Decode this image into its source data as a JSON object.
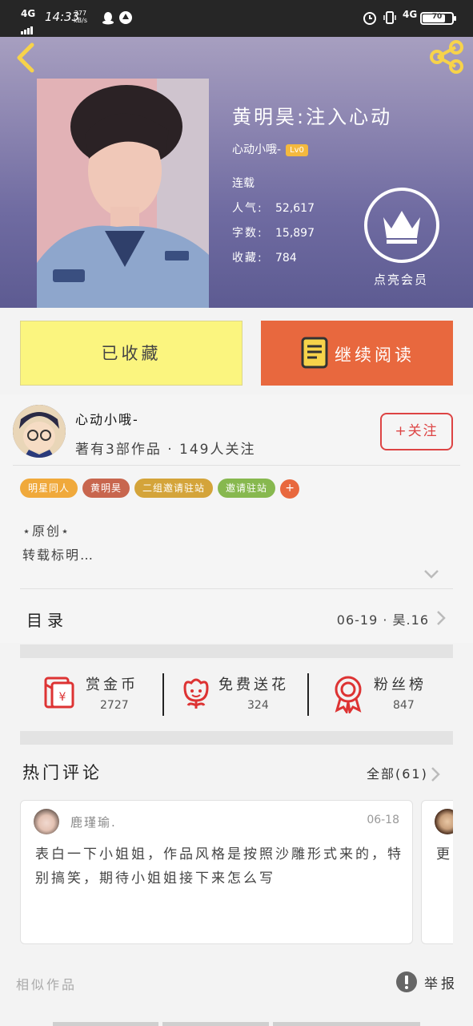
{
  "status_bar": {
    "network": "4G",
    "time": "14:33",
    "speed_top": "277",
    "speed_unit": "kB/s",
    "right_network": "4G",
    "battery": "70"
  },
  "book": {
    "title": "黄明昊:注入心动",
    "author": "心动小哦-",
    "level": "Lv0",
    "status": "连载",
    "stats": [
      {
        "label": "人气:",
        "value": "52,617"
      },
      {
        "label": "字数:",
        "value": "15,897"
      },
      {
        "label": "收藏:",
        "value": "784"
      }
    ],
    "vip_label": "点亮会员"
  },
  "buttons": {
    "collected": "已收藏",
    "continue": "继续阅读"
  },
  "author": {
    "name": "心动小哦-",
    "meta": "著有3部作品 · 149人关注",
    "follow": "+关注"
  },
  "tags": [
    {
      "label": "明星同人",
      "color": "#f0a93b"
    },
    {
      "label": "黄明昊",
      "color": "#c8664e"
    },
    {
      "label": "二组邀请驻站",
      "color": "#d4a43a"
    },
    {
      "label": "邀请驻站",
      "color": "#87b84f"
    }
  ],
  "tag_add": "+",
  "description": {
    "line1": "⋆原创⋆",
    "line2": "转载标明…"
  },
  "toc": {
    "label": "目录",
    "latest": "06-19 · 昊.16"
  },
  "actions": [
    {
      "label": "赏金币",
      "value": "2727",
      "icon": "red-envelope-icon"
    },
    {
      "label": "免费送花",
      "value": "324",
      "icon": "flower-icon"
    },
    {
      "label": "粉丝榜",
      "value": "847",
      "icon": "medal-icon"
    }
  ],
  "comments": {
    "title": "热门评论",
    "all": "全部(61)",
    "items": [
      {
        "user": "鹿瑾瑜.",
        "date": "06-18",
        "text": "表白一下小姐姐，作品风格是按照沙雕形式来的，特别搞笑，期待小姐姐接下来怎么写"
      },
      {
        "text": "更"
      }
    ]
  },
  "footer": {
    "similar": "相似作品",
    "report": "举报"
  },
  "colors": {
    "accent_orange": "#e8683e",
    "collected_yellow": "#fbf57f",
    "follow_red": "#dd4444"
  }
}
